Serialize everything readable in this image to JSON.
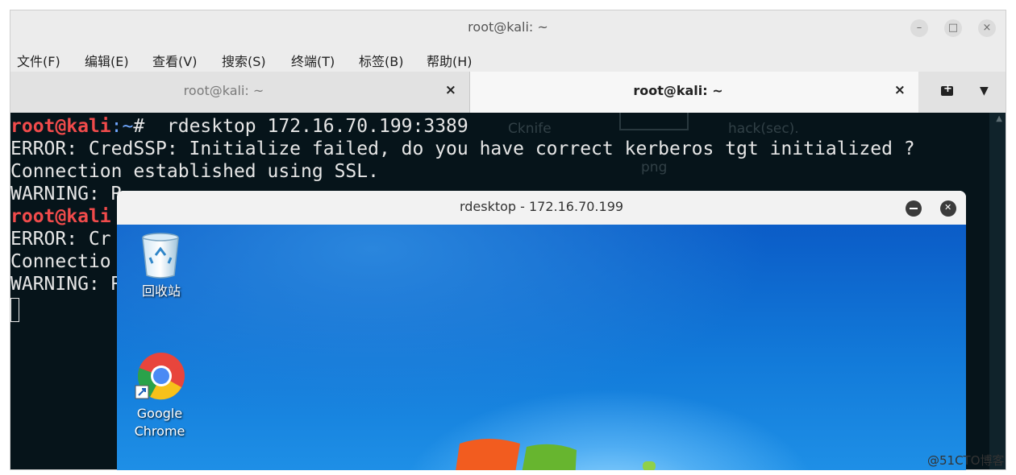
{
  "window": {
    "title": "root@kali: ~",
    "controls": {
      "minimize": "–",
      "maximize": "□",
      "close": "×"
    }
  },
  "menubar": {
    "items": [
      {
        "label": "文件(F)"
      },
      {
        "label": "编辑(E)"
      },
      {
        "label": "查看(V)"
      },
      {
        "label": "搜索(S)"
      },
      {
        "label": "终端(T)"
      },
      {
        "label": "标签(B)"
      },
      {
        "label": "帮助(H)"
      }
    ]
  },
  "tabs": [
    {
      "label": "root@kali: ~",
      "close": "×",
      "active": false
    },
    {
      "label": "root@kali: ~",
      "close": "×",
      "active": true
    }
  ],
  "terminal": {
    "prompt_user": "root@kali",
    "prompt_path": ":~",
    "prompt_symbol": "# ",
    "command": " rdesktop 172.16.70.199:3389",
    "line2": "ERROR: CredSSP: Initialize failed, do you have correct kerberos tgt initialized ?",
    "line3": "Connection established using SSL.",
    "line4": "WARNING: R",
    "line5_prompt": "root@kali",
    "line6": "ERROR: Cr",
    "line7": "Connectio",
    "line8": "WARNING: R",
    "background_files": [
      "Cknife",
      "hack(sec).",
      "png"
    ]
  },
  "rdesktop": {
    "title": "rdesktop - 172.16.70.199",
    "desktop_icons": [
      {
        "label": "回收站"
      },
      {
        "label": "Google\nChrome"
      }
    ]
  },
  "watermark": "@51CTO博客",
  "colors": {
    "terminal_bg": "#06141a",
    "prompt_user": "#f04b4b",
    "prompt_path": "#6fa7ff",
    "desktop_blue": "#127ad9"
  }
}
